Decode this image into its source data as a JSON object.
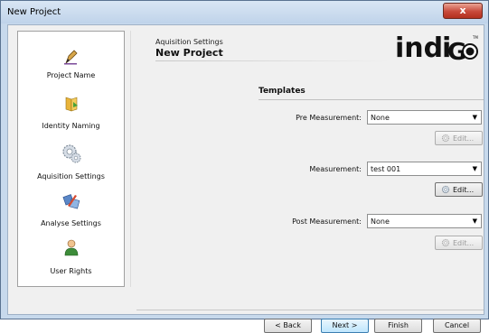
{
  "window": {
    "title": "New Project",
    "close_glyph": "x"
  },
  "sidebar": {
    "items": [
      {
        "label": "Project Name",
        "icon": "pen-icon"
      },
      {
        "label": "Identity Naming",
        "icon": "folder-icon"
      },
      {
        "label": "Aquisition Settings",
        "icon": "gear-icon"
      },
      {
        "label": "Analyse Settings",
        "icon": "tools-icon"
      },
      {
        "label": "User Rights",
        "icon": "user-icon"
      }
    ]
  },
  "header": {
    "subtitle": "Aquisition Settings",
    "title": "New Project",
    "logo_text": "indiGo",
    "logo_mark": "TM"
  },
  "templates": {
    "section_title": "Templates",
    "rows": [
      {
        "label": "Pre Measurement:",
        "value": "None",
        "edit_label": "Edit...",
        "edit_enabled": false
      },
      {
        "label": "Measurement:",
        "value": "test 001",
        "edit_label": "Edit...",
        "edit_enabled": true
      },
      {
        "label": "Post Measurement:",
        "value": "None",
        "edit_label": "Edit...",
        "edit_enabled": false
      }
    ]
  },
  "footer": {
    "back_label": "< Back",
    "next_label": "Next >",
    "finish_label": "Finish",
    "cancel_label": "Cancel"
  },
  "colors": {
    "accent": "#3c7fb1",
    "close_red": "#c8493a"
  }
}
